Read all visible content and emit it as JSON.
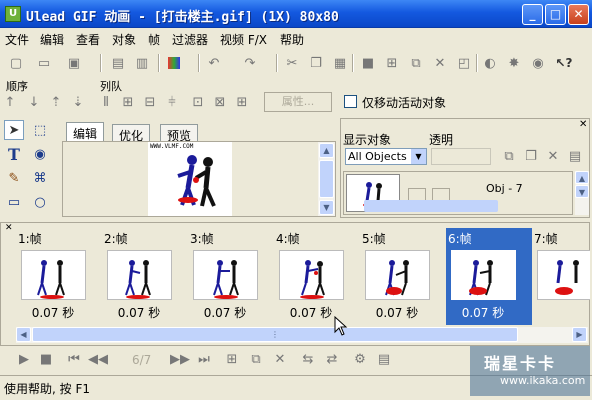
{
  "window": {
    "title": "Ulead GIF 动画 - [打击楼主.gif] (1X) 80x80",
    "minimize": "_",
    "maximize": "□",
    "close": "✕"
  },
  "menu": [
    "文件",
    "编辑",
    "查看",
    "对象",
    "帧",
    "过滤器",
    "视频 F/X",
    "帮助"
  ],
  "toolbar2": {
    "order_label": "顺序",
    "align_label": "列队",
    "properties_button": "属性...",
    "move_active_only": "仅移动活动对象"
  },
  "tabs": [
    "编辑",
    "优化",
    "预览"
  ],
  "preview_site_text": "WWW.VLMF.COM",
  "objects_panel": {
    "show_objects_label": "显示对象",
    "transparency_label": "透明",
    "filter_value": "All Objects",
    "object_name": "Obj - 7"
  },
  "frames": [
    {
      "label": "1:帧",
      "delay": "0.07 秒"
    },
    {
      "label": "2:帧",
      "delay": "0.07 秒"
    },
    {
      "label": "3:帧",
      "delay": "0.07 秒"
    },
    {
      "label": "4:帧",
      "delay": "0.07 秒"
    },
    {
      "label": "5:帧",
      "delay": "0.07 秒"
    },
    {
      "label": "6:帧",
      "delay": "0.07 秒",
      "selected": true
    },
    {
      "label": "7:帧",
      "delay": ""
    }
  ],
  "playback": {
    "frame_counter": "6/7"
  },
  "status": {
    "text": "使用帮助, 按 F1",
    "watermark_brand": "瑞星卡卡",
    "watermark_url": "www.ikaka.com"
  },
  "colors": {
    "title_bar": "#1459e0",
    "selection": "#316ac5",
    "face": "#ece9d8"
  }
}
